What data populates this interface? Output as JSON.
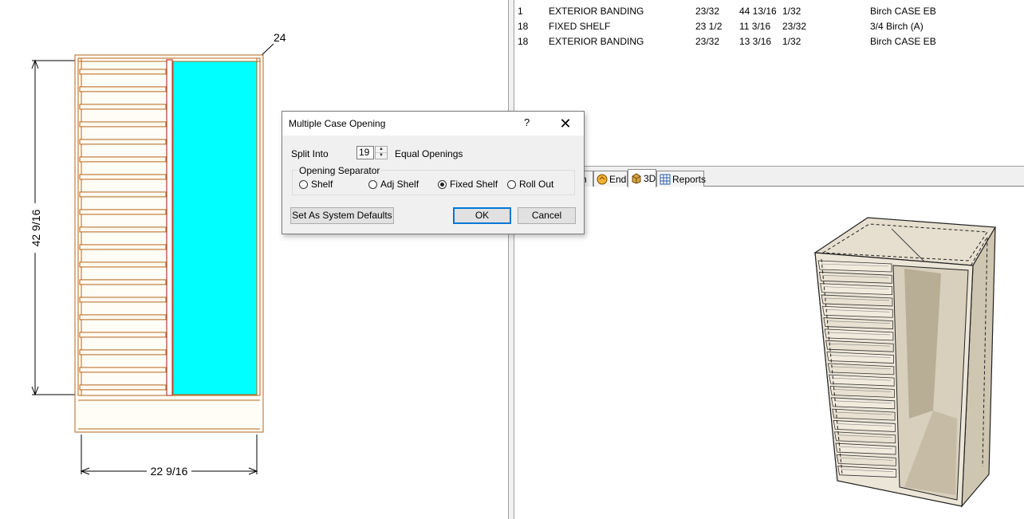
{
  "elevation": {
    "height_dim": "42 9/16",
    "width_dim": "22 9/16",
    "callout": "24"
  },
  "report": {
    "rows": [
      {
        "qty": "1",
        "name": "EXTERIOR BANDING",
        "c1": "23/32",
        "c2": "44 13/16",
        "c3": "1/32",
        "material": "Birch CASE EB"
      },
      {
        "qty": "18",
        "name": "FIXED SHELF",
        "c1": "23 1/2",
        "c2": "11 3/16",
        "c3": "23/32",
        "material": "3/4 Birch (A)"
      },
      {
        "qty": "18",
        "name": "EXTERIOR BANDING",
        "c1": "23/32",
        "c2": "13 3/16",
        "c3": "1/32",
        "material": "Birch CASE EB"
      }
    ]
  },
  "tabs": [
    {
      "label": "n",
      "icon": "elevation-icon"
    },
    {
      "label": "End",
      "icon": "end-view-icon"
    },
    {
      "label": "3D",
      "icon": "cube-3d-icon"
    },
    {
      "label": "Reports",
      "icon": "report-grid-icon"
    }
  ],
  "dialog": {
    "title": "Multiple Case Opening",
    "help": "?",
    "close": "✕",
    "split_label": "Split Into",
    "split_value": "19",
    "equal_label": "Equal Openings",
    "group_label": "Opening Separator",
    "options": [
      {
        "label": "Shelf",
        "checked": false
      },
      {
        "label": "Adj Shelf",
        "checked": false
      },
      {
        "label": "Fixed Shelf",
        "checked": true
      },
      {
        "label": "Roll Out",
        "checked": false
      }
    ],
    "defaults_button": "Set As System Defaults",
    "ok_button": "OK",
    "cancel_button": "Cancel"
  },
  "colors": {
    "cabinet_line": "#b5651d",
    "opening_fill": "#00ffff",
    "shelf_fill": "#fff8e8",
    "model_light": "#e4dccb",
    "model_dark": "#b3a993"
  }
}
